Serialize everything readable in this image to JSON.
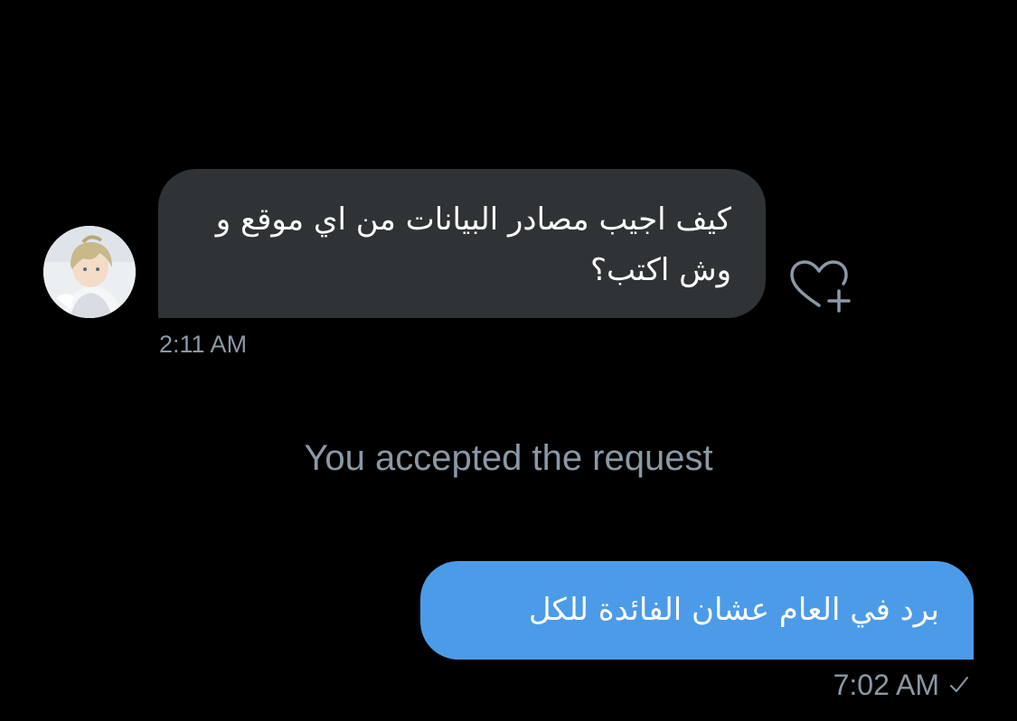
{
  "conversation": {
    "incoming": {
      "text": "كيف اجيب مصادر البيانات من اي موقع و وش اكتب؟",
      "time": "2:11 AM",
      "avatar_icon": "avatar-anime-character"
    },
    "system_message": "You accepted the request",
    "outgoing": {
      "text": "برد في العام عشان الفائدة للكل",
      "time": "7:02 AM",
      "status_icon": "sent-check-icon"
    }
  },
  "colors": {
    "background": "#000000",
    "incoming_bubble": "#2f3336",
    "outgoing_bubble": "#4c9be8",
    "secondary_text": "#8b98a5"
  }
}
